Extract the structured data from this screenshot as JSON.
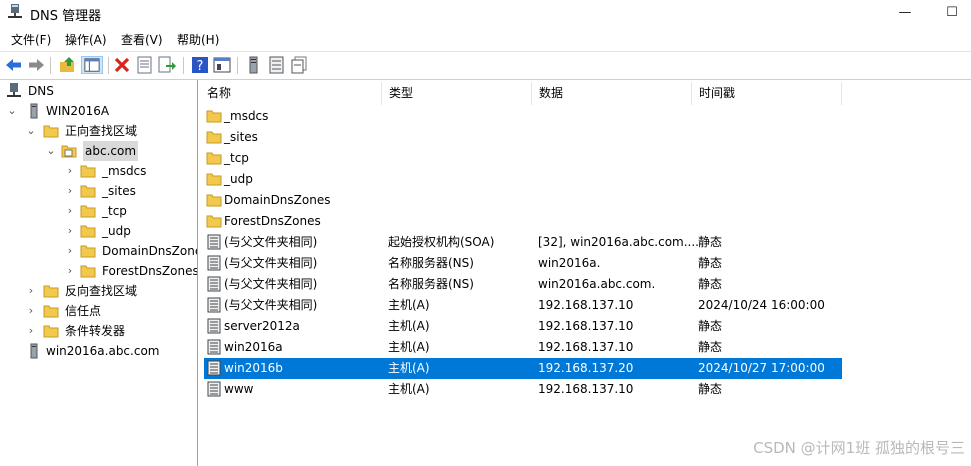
{
  "window": {
    "title": "DNS 管理器",
    "minimize_glyph": "—",
    "maximize_glyph": "☐"
  },
  "menu": [
    "文件(F)",
    "操作(A)",
    "查看(V)",
    "帮助(H)"
  ],
  "toolbar_icons": [
    "back-arrow-icon",
    "forward-arrow-icon",
    "up-folder-icon",
    "show-hide-tree-icon",
    "delete-icon",
    "properties-icon",
    "export-list-icon",
    "help-icon",
    "console-view-icon",
    "server-icon",
    "list-icon",
    "records-icon"
  ],
  "tree": {
    "root": "DNS",
    "server": "WIN2016A",
    "forward_zones": "正向查找区域",
    "zone": "abc.com",
    "zone_children": [
      "_msdcs",
      "_sites",
      "_tcp",
      "_udp",
      "DomainDnsZones",
      "ForestDnsZones"
    ],
    "reverse_zones": "反向查找区域",
    "trust_points": "信任点",
    "conditional_forwarders": "条件转发器",
    "other_server": "win2016a.abc.com"
  },
  "list": {
    "columns": [
      "名称",
      "类型",
      "数据",
      "时间戳"
    ],
    "folders": [
      "_msdcs",
      "_sites",
      "_tcp",
      "_udp",
      "DomainDnsZones",
      "ForestDnsZones"
    ],
    "records": [
      {
        "name": "(与父文件夹相同)",
        "type": "起始授权机构(SOA)",
        "data": "[32], win2016a.abc.com....",
        "timestamp": "静态"
      },
      {
        "name": "(与父文件夹相同)",
        "type": "名称服务器(NS)",
        "data": "win2016a.",
        "timestamp": "静态"
      },
      {
        "name": "(与父文件夹相同)",
        "type": "名称服务器(NS)",
        "data": "win2016a.abc.com.",
        "timestamp": "静态"
      },
      {
        "name": "(与父文件夹相同)",
        "type": "主机(A)",
        "data": "192.168.137.10",
        "timestamp": "2024/10/24 16:00:00"
      },
      {
        "name": "server2012a",
        "type": "主机(A)",
        "data": "192.168.137.10",
        "timestamp": "静态"
      },
      {
        "name": "win2016a",
        "type": "主机(A)",
        "data": "192.168.137.10",
        "timestamp": "静态"
      },
      {
        "name": "win2016b",
        "type": "主机(A)",
        "data": "192.168.137.20",
        "timestamp": "2024/10/27 17:00:00"
      },
      {
        "name": "www",
        "type": "主机(A)",
        "data": "192.168.137.10",
        "timestamp": "静态"
      }
    ],
    "selected_record": "win2016b"
  },
  "watermark": "CSDN @计网1班 孤独的根号三",
  "colors": {
    "selection": "#0078d7",
    "folder": "#f2c94c",
    "delete": "#d9261c",
    "help": "#2a55c4"
  }
}
